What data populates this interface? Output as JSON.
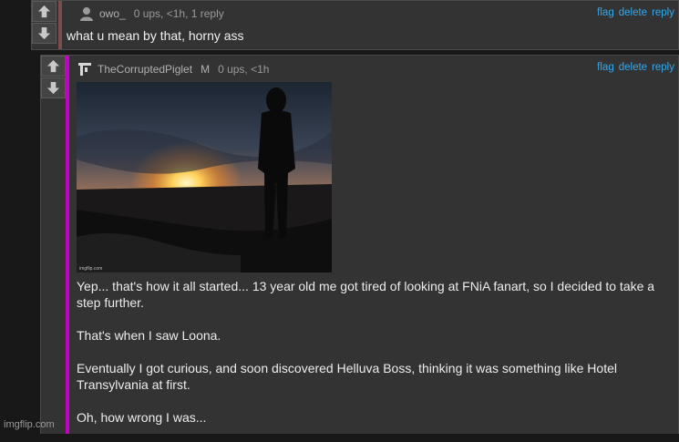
{
  "comment1": {
    "username": "owo_",
    "meta": "0 ups, <1h, 1 reply",
    "text": "what u mean by that, horny ass",
    "actions": [
      "flag",
      "delete",
      "reply"
    ]
  },
  "comment2": {
    "username": "TheCorruptedPiglet",
    "badge": "M",
    "meta": "0 ups, <1h",
    "actions": [
      "flag",
      "delete",
      "reply"
    ],
    "image_watermark": "imgflip.com",
    "paragraphs": [
      "Yep... that's how it all started... 13 year old me got tired of looking at FNiA fanart, so I decided to take a step further.",
      "That's when I saw Loona.",
      "Eventually I got curious, and soon discovered Helluva Boss, thinking it was something like Hotel Transylvania at first.",
      "Oh, how wrong I was..."
    ]
  },
  "watermark": "imgflip.com",
  "colors": {
    "link": "#37a8e8",
    "reply_stripe": "#c400c4",
    "parent_stripe": "#7a4c4c"
  }
}
